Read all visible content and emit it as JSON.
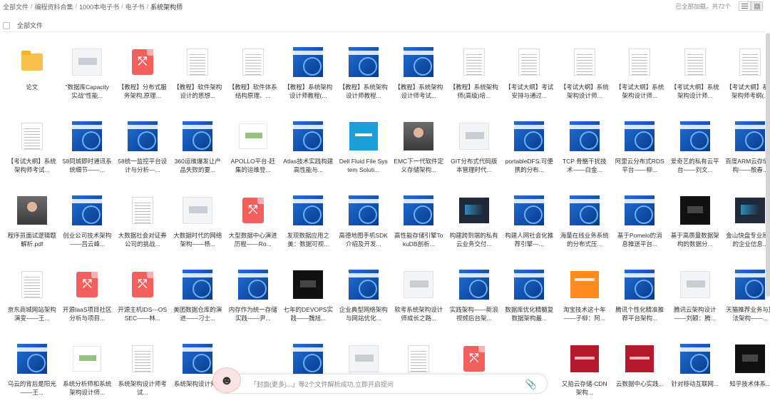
{
  "breadcrumb": [
    "全部文件",
    "编程资料合集",
    "1000本电子书",
    "电子书",
    "系统架构师"
  ],
  "status": "已全部加载，共72个",
  "select_all": "全部文件",
  "chat": {
    "placeholder": "「封面(更多)...」等2个文件解析成功,立即开启提问"
  },
  "files": [
    {
      "label": "论文",
      "thumb": "folder"
    },
    {
      "label": "\"数据库Capacity实战\"性能...",
      "thumb": "light"
    },
    {
      "label": "【教程】分布式服务架构,原理...",
      "thumb": "pdf"
    },
    {
      "label": "【教程】软件架构设计的思想...",
      "thumb": "doc"
    },
    {
      "label": "【教程】软件体系结构原理、...",
      "thumb": "doc"
    },
    {
      "label": "【教程】系统架构设计师教程(...",
      "thumb": "blue"
    },
    {
      "label": "【教程】系统架构设计师教程...",
      "thumb": "blue"
    },
    {
      "label": "【教程】系统架构设计师考试...",
      "thumb": "blue"
    },
    {
      "label": "【教程】系统架构师(高级)培...",
      "thumb": "doc"
    },
    {
      "label": "【考试大纲】考试安排与通过...",
      "thumb": "doc"
    },
    {
      "label": "【考试大纲】系统架构设计师...",
      "thumb": "doc"
    },
    {
      "label": "【考试大纲】系统架构设计师...",
      "thumb": "doc"
    },
    {
      "label": "【考试大纲】系统架构设计师...",
      "thumb": "doc"
    },
    {
      "label": "【考试大纲】系统架构师考纲(...",
      "thumb": "doc"
    },
    {
      "label": "【考试大纲】系统架构师考试...",
      "thumb": "doc"
    },
    {
      "label": "58同城即时通讯系统细节——...",
      "thumb": "blue"
    },
    {
      "label": "58统一监控平台设计与分析—...",
      "thumb": "blue"
    },
    {
      "label": "360运维爆发让产品失败的要...",
      "thumb": "blue"
    },
    {
      "label": "APOLLO平台-赶集的运维登...",
      "thumb": "white"
    },
    {
      "label": "Atlas技术实践构建高性能与...",
      "thumb": "blue"
    },
    {
      "label": "Dell Fluid File System Soluti...",
      "thumb": "cyan"
    },
    {
      "label": "EMC下一代软件定义存储架构...",
      "thumb": "photo"
    },
    {
      "label": "GIT分布式代码版本管理时代...",
      "thumb": "light"
    },
    {
      "label": "portableDFS:可便携的分布...",
      "thumb": "blue"
    },
    {
      "label": "TCP 骨骼干扰技术——白金...",
      "thumb": "blue"
    },
    {
      "label": "阿里云分布式RDS平台——柳...",
      "thumb": "blue"
    },
    {
      "label": "爱奇艺的私有云平台——刘文...",
      "thumb": "blue"
    },
    {
      "label": "百度ARM云存储架构——殷春...",
      "thumb": "blue"
    },
    {
      "label": "程序员面试逻辑题解析.pdf",
      "thumb": "photo"
    },
    {
      "label": "创业公司技术架构——吕云峰...",
      "thumb": "blue"
    },
    {
      "label": "大数据社会对证券公司的挑战...",
      "thumb": "doc"
    },
    {
      "label": "大数据时代的网络架构——杨...",
      "thumb": "light"
    },
    {
      "label": "大型数据中心演进历程——Ro...",
      "thumb": "pdf"
    },
    {
      "label": "发现数据应用之美：数据可视...",
      "thumb": "blue"
    },
    {
      "label": "高德地图手机SDK介绍及开发...",
      "thumb": "blue"
    },
    {
      "label": "高性能存储引擎TokuDB剖析...",
      "thumb": "blue"
    },
    {
      "label": "构建跨到端的私有云业务交付...",
      "thumb": "dark"
    },
    {
      "label": "构建人网社会化推荐引擎—...",
      "thumb": "blue"
    },
    {
      "label": "海量在线业务系统的分布式压...",
      "thumb": "blue"
    },
    {
      "label": "基于Pomelo的消息推送平台...",
      "thumb": "blue"
    },
    {
      "label": "基于高质量数据架构的数据分...",
      "thumb": "black"
    },
    {
      "label": "金山快盘专业局用的企业信息...",
      "thumb": "dark"
    },
    {
      "label": "京东商城网站架构演变——王...",
      "thumb": "doc"
    },
    {
      "label": "开源IaaS项目社区分析与项目...",
      "thumb": "pdf"
    },
    {
      "label": "开源主机IDS---OSSEC——林...",
      "thumb": "pdf"
    },
    {
      "label": "美团数据仓库的演进——刁士...",
      "thumb": "blue"
    },
    {
      "label": "内存作为统一存储实践——尹...",
      "thumb": "blue"
    },
    {
      "label": "七年的DEVOPS实践——魏旭...",
      "thumb": "black"
    },
    {
      "label": "企业典型网络架构与网站优化...",
      "thumb": "blue"
    },
    {
      "label": "软考系统架构设计师成长之路...",
      "thumb": "light"
    },
    {
      "label": "实践架构——新浪视频后台架...",
      "thumb": "blue"
    },
    {
      "label": "数据库优化精髓复数据架构最...",
      "thumb": "blue"
    },
    {
      "label": "淘宝技术这十年——子柳：阿...",
      "thumb": "orange"
    },
    {
      "label": "腾讯个性化精准推荐平台架构...",
      "thumb": "blue"
    },
    {
      "label": "腾讯云架构设计——刘颖：腾...",
      "thumb": "light"
    },
    {
      "label": "天猫推荐业务与算法架构——...",
      "thumb": "blue"
    },
    {
      "label": "乌云的背后是阳光——王...",
      "thumb": "blue"
    },
    {
      "label": "系统分析师和系统架构设计师...",
      "thumb": "white"
    },
    {
      "label": "系统架构设计师考试...",
      "thumb": "doc"
    },
    {
      "label": "系统架构设计师...",
      "thumb": "blue"
    },
    {
      "label": "",
      "thumb": "none"
    },
    {
      "label": "",
      "thumb": "blue"
    },
    {
      "label": "",
      "thumb": "light"
    },
    {
      "label": "",
      "thumb": "doc"
    },
    {
      "label": "",
      "thumb": "pdf"
    },
    {
      "label": "",
      "thumb": "none"
    },
    {
      "label": "又拍云存储-CDN架构...",
      "thumb": "red"
    },
    {
      "label": "云数据中心实践...",
      "thumb": "red"
    },
    {
      "label": "针对移动互联网...",
      "thumb": "blue"
    },
    {
      "label": "知乎技术体系...",
      "thumb": "black"
    }
  ]
}
